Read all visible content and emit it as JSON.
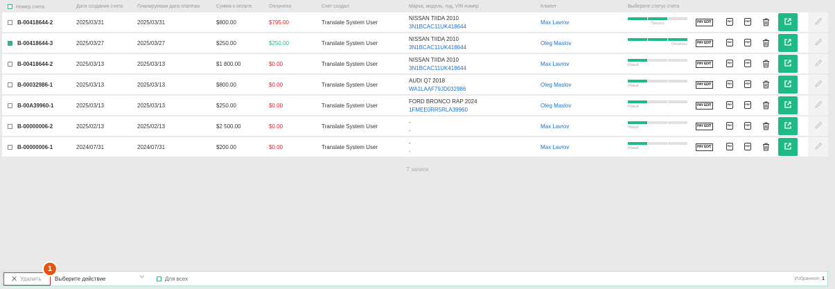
{
  "columns": {
    "invoice": "Номер счета",
    "created": "Дата создания счета",
    "planned": "Планируемая дата платежа",
    "amount": "Сумма к оплате",
    "paid": "Оплачено",
    "created_by": "Счет создал",
    "vehicle": "Марка, модель, год, VIN номер",
    "client": "Клиент",
    "status": "Выберите статус счета"
  },
  "rows": [
    {
      "checked": false,
      "invoice": "B-00418644-2",
      "created": "2025/03/31",
      "planned": "2025/03/31",
      "amount": "$800.00",
      "paid": "$795.00",
      "paid_color": "red",
      "author": "Translate System User",
      "car": "NISSAN TIIDA 2010",
      "vin": "3N1BCAC11UK418644",
      "client": "Max Lavrov",
      "status_label": "Процесс",
      "status_progress": 0.66,
      "status_align": "center"
    },
    {
      "checked": true,
      "invoice": "B-00418644-3",
      "created": "2025/03/27",
      "planned": "2025/03/27",
      "amount": "$250.00",
      "paid": "$250.00",
      "paid_color": "green",
      "author": "Translate System User",
      "car": "NISSAN TIIDA 2010",
      "vin": "3N1BCAC11UK418644",
      "client": "Oleg Maslov",
      "status_label": "Оплачено",
      "status_progress": 1.0,
      "status_align": "right"
    },
    {
      "checked": false,
      "invoice": "B-00418644-2",
      "created": "2025/03/13",
      "planned": "2025/03/13",
      "amount": "$1 800.00",
      "paid": "$0.00",
      "paid_color": "red",
      "author": "Translate System User",
      "car": "NISSAN TIIDA 2010",
      "vin": "3N1BCAC11UK418644",
      "client": "Max Lavrov",
      "status_label": "Новый",
      "status_progress": 0.33,
      "status_align": "left"
    },
    {
      "checked": false,
      "invoice": "B-00032986-1",
      "created": "2025/03/13",
      "planned": "2025/03/13",
      "amount": "$800.00",
      "paid": "$0.00",
      "paid_color": "red",
      "author": "Translate System User",
      "car": "AUDI Q7 2018",
      "vin": "WA1LAAF79JD032986",
      "client": "Oleg Maslov",
      "status_label": "Новый",
      "status_progress": 0.33,
      "status_align": "left"
    },
    {
      "checked": false,
      "invoice": "B-00A39960-1",
      "created": "2025/03/13",
      "planned": "2025/03/13",
      "amount": "$250.00",
      "paid": "$0.00",
      "paid_color": "red",
      "author": "Translate System User",
      "car": "FORD BRONCO RAP 2024",
      "vin": "1FMEE0RR5RLA39960",
      "client": "Oleg Maslov",
      "status_label": "Новый",
      "status_progress": 0.33,
      "status_align": "left"
    },
    {
      "checked": false,
      "invoice": "B-00000006-2",
      "created": "2025/02/13",
      "planned": "2025/02/13",
      "amount": "$2 500.00",
      "paid": "$0.00",
      "paid_color": "red",
      "author": "Translate System User",
      "car": "-",
      "vin": "-",
      "client": "Max Lavrov",
      "status_label": "Новый",
      "status_progress": 0.33,
      "status_align": "left"
    },
    {
      "checked": false,
      "invoice": "B-00000006-1",
      "created": "2024/07/31",
      "planned": "2024/07/31",
      "amount": "$200.00",
      "paid": "$0.00",
      "paid_color": "red",
      "author": "Translate System User",
      "car": "-",
      "vin": "-",
      "client": "Max Lavrov",
      "status_label": "Новый",
      "status_progress": 0.33,
      "status_align": "left"
    }
  ],
  "row_actions": {
    "pay_edit": "PAY EDIT",
    "pay": "PAY",
    "pdf": "PDF",
    "delete_icon": "trash-icon",
    "open_icon": "external-link-icon",
    "edit_icon": "pencil-icon"
  },
  "records_count": "7 записи",
  "bottom": {
    "delete_label": "Удалить",
    "badge": "1",
    "action_placeholder": "Выберите действие",
    "for_all": "Для всех",
    "favorites_label": "Избранное:",
    "favorites_count": "1"
  },
  "colors": {
    "accent": "#20b988",
    "danger": "#e02424",
    "link": "#1a73c7",
    "badge": "#e8530e"
  }
}
